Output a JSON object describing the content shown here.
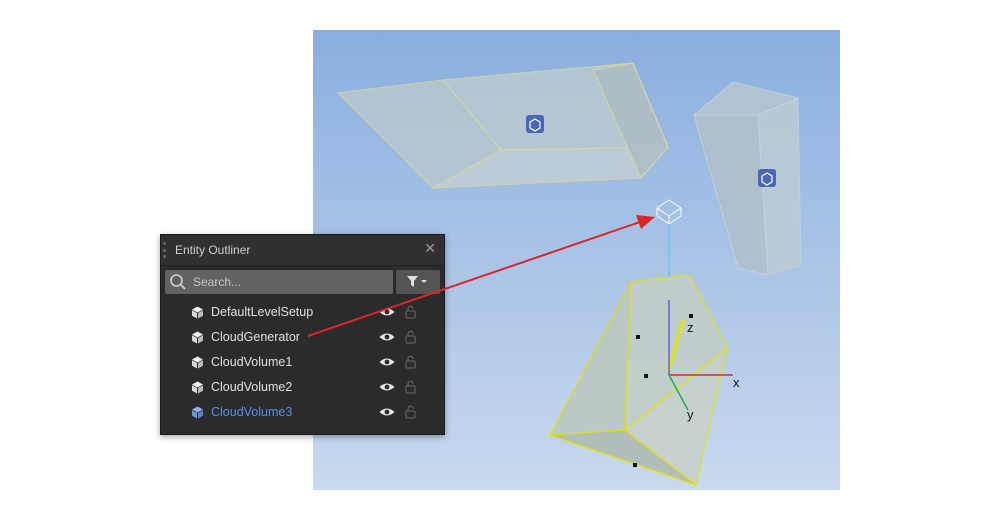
{
  "outliner": {
    "title": "Entity Outliner",
    "close_glyph": "✕",
    "search_placeholder": "Search...",
    "entities": [
      {
        "label": "DefaultLevelSetup",
        "selected": false
      },
      {
        "label": "CloudGenerator",
        "selected": false
      },
      {
        "label": "CloudVolume1",
        "selected": false
      },
      {
        "label": "CloudVolume2",
        "selected": false
      },
      {
        "label": "CloudVolume3",
        "selected": true
      }
    ]
  },
  "viewport": {
    "axis_labels": {
      "x": "x",
      "y": "y",
      "z": "z"
    }
  },
  "colors": {
    "panel_bg": "#2b2b2b",
    "selected_text": "#5b8de4",
    "selection_outline": "#e4e400",
    "annotation_arrow": "#d8262a"
  },
  "icons": [
    "entity-cube-icon",
    "search-icon",
    "filter-icon",
    "eye-icon",
    "lock-icon",
    "close-icon"
  ]
}
